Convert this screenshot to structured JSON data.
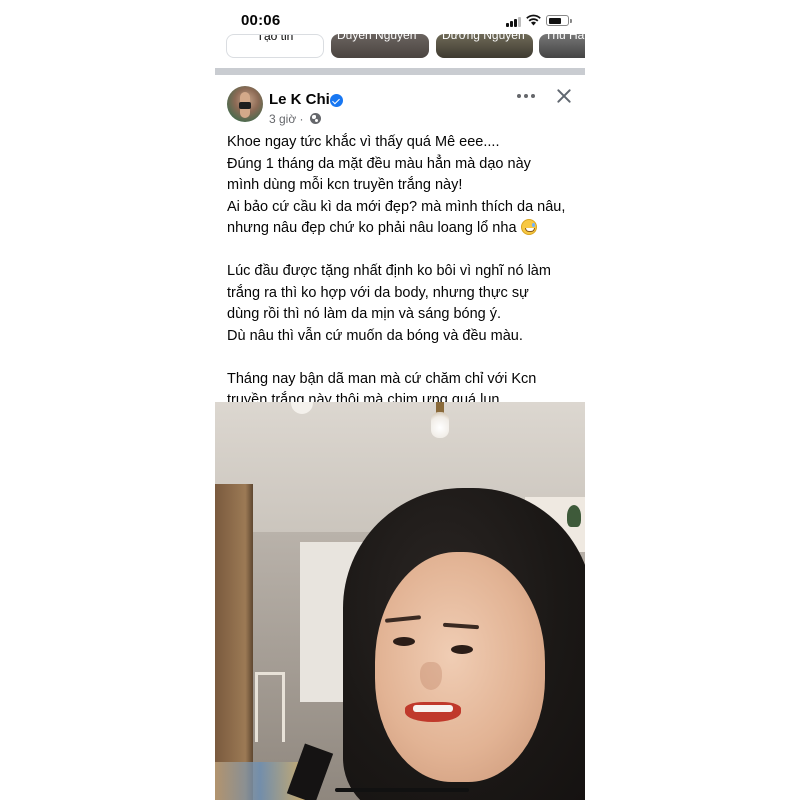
{
  "status_bar": {
    "time": "00:06",
    "signal_bars": 3,
    "signal_bars_total": 4,
    "battery_level_percent": 75
  },
  "stories": {
    "create_label": "Tạo tin",
    "users": [
      "Duyên Nguyễn",
      "Dương Nguyễn",
      "Thu Hà"
    ]
  },
  "post": {
    "author": "Le K Chi",
    "verified": true,
    "time": "3 giờ ·",
    "audience_icon": "globe-icon",
    "lines": [
      "Khoe ngay tức khắc vì thấy quá Mê eee....",
      "Đúng 1 tháng da mặt đều màu hẳn mà dạo này",
      "mình dùng mỗi kcn truyền trắng này!",
      "Ai bảo cứ cầu kì da mới đẹp? mà mình thích da nâu,",
      "nhưng nâu đẹp chứ ko phải nâu loang lổ nha",
      "",
      "Lúc đầu được tặng nhất định ko bôi vì nghĩ nó làm",
      "trắng ra thì ko hợp với da body, nhưng thực sự",
      "dùng rồi thì nó làm da mịn và sáng bóng ý.",
      "Dù nâu thì vẫn cứ muốn da bóng và đều màu.",
      "",
      "Tháng nay bận dã man mà cứ chăm chỉ với Kcn",
      "truyền trắng này thôi mà chim ưng quá lun..."
    ],
    "emoji_icon": "grinning-sweat-emoji-icon"
  },
  "colors": {
    "verified_blue": "#1877f2",
    "secondary_text": "#65676b",
    "divider_gray": "#c9ccd1"
  }
}
